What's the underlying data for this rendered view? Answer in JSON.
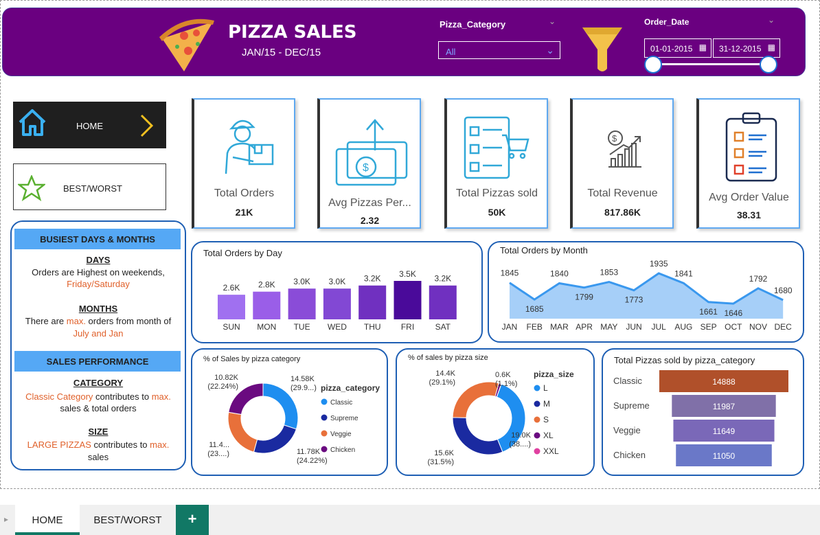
{
  "header": {
    "title": "PIZZA SALES",
    "subtitle": "JAN/15 - DEC/15",
    "category_label": "Pizza_Category",
    "category_value": "All",
    "date_label": "Order_Date",
    "date_start": "01-01-2015",
    "date_end": "31-12-2015"
  },
  "nav": {
    "home": "HOME",
    "best": "BEST/WORST"
  },
  "kpis": [
    {
      "label": "Total Orders",
      "value": "21K"
    },
    {
      "label": "Avg Pizzas Per...",
      "value": "2.32"
    },
    {
      "label": "Total Pizzas sold",
      "value": "50K"
    },
    {
      "label": "Total Revenue",
      "value": "817.86K"
    },
    {
      "label": "Avg Order Value",
      "value": "38.31"
    }
  ],
  "side": {
    "busiest_title": "BUSIEST DAYS & MONTHS",
    "days_h": "DAYS",
    "days_t1": "Orders are Highest on weekends,",
    "days_t2": "Friday/Saturday",
    "months_h": "MONTHS",
    "months_t1a": "There are ",
    "months_t1b": "max.",
    "months_t1c": " orders from month of",
    "months_t2": "July and Jan",
    "sales_title": "SALES PERFORMANCE",
    "cat_h": "CATEGORY",
    "cat_t1a": "Classic Category",
    "cat_t1b": "  contributes to ",
    "cat_t1c": "max.",
    "cat_t2": "sales & total orders",
    "size_h": "SIZE",
    "size_t1a": "LARGE PIZZAS",
    "size_t1b": " contributes to ",
    "size_t1c": "max.",
    "size_t2": "sales"
  },
  "tabs": {
    "home": "HOME",
    "best": "BEST/WORST",
    "add": "+"
  },
  "chart_data": [
    {
      "type": "bar",
      "title": "Total Orders by Day",
      "categories": [
        "SUN",
        "MON",
        "TUE",
        "WED",
        "THU",
        "FRI",
        "SAT"
      ],
      "values": [
        2.6,
        2.8,
        3.0,
        3.0,
        3.2,
        3.5,
        3.2
      ],
      "labels": [
        "2.6K",
        "2.8K",
        "3.0K",
        "3.0K",
        "3.2K",
        "3.5K",
        "3.2K"
      ],
      "colors": [
        "#a070f0",
        "#9a5ee8",
        "#8a4cd8",
        "#8248d4",
        "#7030c0",
        "#4a0a9a",
        "#7030c0"
      ]
    },
    {
      "type": "area",
      "title": "Total Orders by Month",
      "categories": [
        "JAN",
        "FEB",
        "MAR",
        "APR",
        "MAY",
        "JUN",
        "JUL",
        "AUG",
        "SEP",
        "OCT",
        "NOV",
        "DEC"
      ],
      "values": [
        1845,
        1685,
        1840,
        1799,
        1853,
        1773,
        1935,
        1841,
        1661,
        1646,
        1792,
        1680
      ]
    },
    {
      "type": "pie",
      "title": "% of Sales by pizza category",
      "legend_title": "pizza_category",
      "slices": [
        {
          "name": "Classic",
          "value": 14.58,
          "label": "14.58K",
          "pct": "(29.9...)",
          "color": "#1e8ef0"
        },
        {
          "name": "Supreme",
          "value": 11.78,
          "label": "11.78K",
          "pct": "(24.22%)",
          "color": "#1a2aa0"
        },
        {
          "name": "Veggie",
          "value": 11.4,
          "label": "11.4...",
          "pct": "(23....)",
          "color": "#e8703a"
        },
        {
          "name": "Chicken",
          "value": 10.82,
          "label": "10.82K",
          "pct": "(22.24%)",
          "color": "#6a0a80"
        }
      ]
    },
    {
      "type": "pie",
      "title": "% of sales by pizza size",
      "legend_title": "pizza_size",
      "slices": [
        {
          "name": "L",
          "value": 19.0,
          "label": "19.0K",
          "pct": "(38....)",
          "color": "#1e8ef0"
        },
        {
          "name": "M",
          "value": 15.6,
          "label": "15.6K",
          "pct": "(31.5%)",
          "color": "#1a2aa0"
        },
        {
          "name": "S",
          "value": 14.4,
          "label": "14.4K",
          "pct": "(29.1%)",
          "color": "#e8703a"
        },
        {
          "name": "XL",
          "value": 0.55,
          "label": "0.6K",
          "pct": "(1.1%)",
          "color": "#6a0a80"
        },
        {
          "name": "XXL",
          "value": 0.03,
          "label": "",
          "pct": "",
          "color": "#e040a0"
        }
      ]
    },
    {
      "type": "bar",
      "title": "Total Pizzas sold by pizza_category",
      "categories": [
        "Classic",
        "Supreme",
        "Veggie",
        "Chicken"
      ],
      "values": [
        14888,
        11987,
        11649,
        11050
      ],
      "colors": [
        "#b0502a",
        "#8070a8",
        "#7a68b8",
        "#6a78c8"
      ]
    }
  ]
}
